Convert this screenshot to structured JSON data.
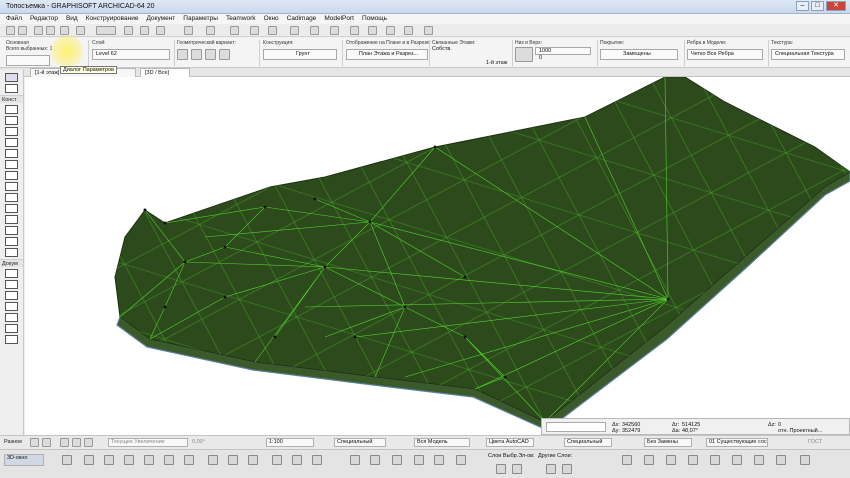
{
  "window": {
    "title": "Топосъемка - GRAPHISOFT ARCHICAD-64 20",
    "controls": {
      "minimize": "–",
      "maximize": "□",
      "close": "✕"
    }
  },
  "menu": [
    "Файл",
    "Редактор",
    "Вид",
    "Конструирование",
    "Документ",
    "Параметры",
    "Teamwork",
    "Окно",
    "Cadimage",
    "ModelPort",
    "Помощь"
  ],
  "infobox": {
    "basic_label": "Основная",
    "selected_label": "Всего выбранных: 1",
    "layer_label": "Слой:",
    "layer_value": "Level 62",
    "geometry_label": "Геометрический вариант:",
    "construction_label": "Конструкция:",
    "construction_value": "Грунт",
    "display_label": "Отображение на Плане и в Разрезе:",
    "display_value": "План Этажа и Разрез...",
    "linked_floors_label": "Связанные Этажи:",
    "linked_floors_value": "Собств.",
    "floor_value": "1-й этаж",
    "offset_label": "Низ и Верх:",
    "offset_top": "1000",
    "offset_bottom": "0",
    "surface_label": "Покрытие:",
    "surface_value": "Замещены",
    "edges_label": "Ребра в Модели:",
    "edges_value": "Четко Все Ребра",
    "texture_label": "Текстура:",
    "texture_value": "Специальная Текстура"
  },
  "tooltip": "Диалог Параметров",
  "tabs": [
    "[1-й этаж]",
    "[3D / Все]"
  ],
  "palette": {
    "sections": [
      "Конст",
      "Докум"
    ],
    "tools": [
      "arrow",
      "marquee",
      "wall",
      "column",
      "beam",
      "slab",
      "roof",
      "shell",
      "morph",
      "mesh",
      "curtain-wall",
      "stair",
      "railing",
      "object",
      "zone",
      "dim",
      "level",
      "text",
      "label",
      "fill",
      "line"
    ]
  },
  "coords": {
    "dx_label": "Δx:",
    "dx": "342560",
    "dy_label": "Δy:",
    "dy": "352479",
    "ax_label": "Δr:",
    "ax": "514125",
    "angle_label": "Δa:",
    "angle": "48,07°",
    "dz_label": "Δz:",
    "dz": "0",
    "ref_label": "отн. Проектный..."
  },
  "navbar": {
    "nav_label": "Разное",
    "zoom_label": "Текущее Увеличение",
    "angle": "0,00°",
    "scale": "1:100",
    "pen_set": "Специальный",
    "model": "Вся Модель",
    "colors": "Цвета AutoCAD",
    "override": "Специальный",
    "renovation": "Без Замены",
    "renovation_filter": "01 Существующие сос...",
    "dim_standard": "ГОСТ"
  },
  "quick": {
    "view_button": "3D-окно",
    "layers_label": "Слои Выбр.Эл-ов:",
    "other_layers_label": "Другие Слои:"
  },
  "colors": {
    "mesh_fill": "#2d4a1c",
    "mesh_edge": "#4ed62b",
    "mesh_side": "#3a5a2a",
    "mesh_base": "#5b7fa3"
  }
}
